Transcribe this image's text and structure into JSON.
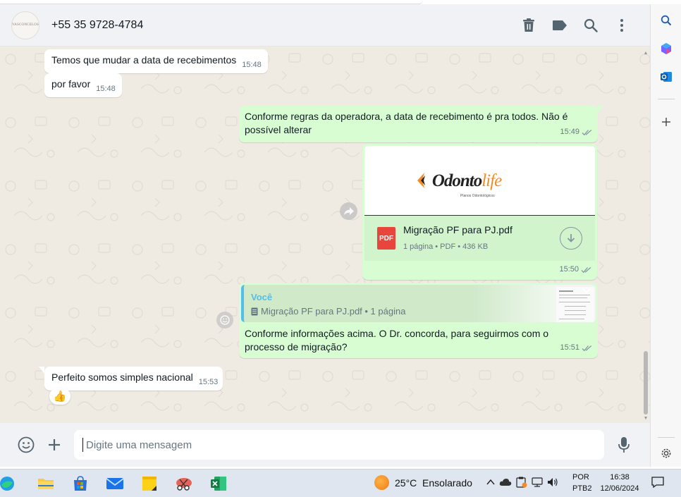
{
  "header": {
    "avatar_text": "VASCONCELOS",
    "contact_name": "+55 35 9728-4784"
  },
  "messages": [
    {
      "text": "Temos que mudar a data de recebimentos",
      "time": "15:48"
    },
    {
      "text": "por favor",
      "time": "15:48"
    },
    {
      "text": "Conforme regras da operadora, a data de recebimento é pra todos. Não é possível alterar",
      "time": "15:49"
    },
    {
      "doc_logo": "Odonto",
      "doc_logo_accent": "life",
      "doc_logo_sub": "Planos Odontológicos",
      "doc_icon_label": "PDF",
      "doc_name": "Migração PF para PJ.pdf",
      "doc_meta": "1 página • PDF • 436 KB",
      "time": "15:50"
    },
    {
      "quote_author": "Você",
      "quote_text": "Migração PF para PJ.pdf • 1 página",
      "text": "Conforme informações acima. O Dr. concorda, para seguirmos com o processo de migração?",
      "time": "15:51"
    },
    {
      "text": "Perfeito somos simples nacional",
      "time": "15:53",
      "reaction": "👍"
    }
  ],
  "composer": {
    "placeholder": "Digite uma mensagem"
  },
  "taskbar": {
    "weather": "25°C  Ensolarado",
    "lang_line1": "POR",
    "lang_line2": "PTB2",
    "time": "16:38",
    "date": "12/06/2024"
  },
  "colors": {
    "outgoing_bubble": "#d9fdd3",
    "incoming_bubble": "#ffffff",
    "chat_bg": "#efeae2",
    "quote_accent": "#53bdeb",
    "pdf_red": "#e8463c"
  }
}
